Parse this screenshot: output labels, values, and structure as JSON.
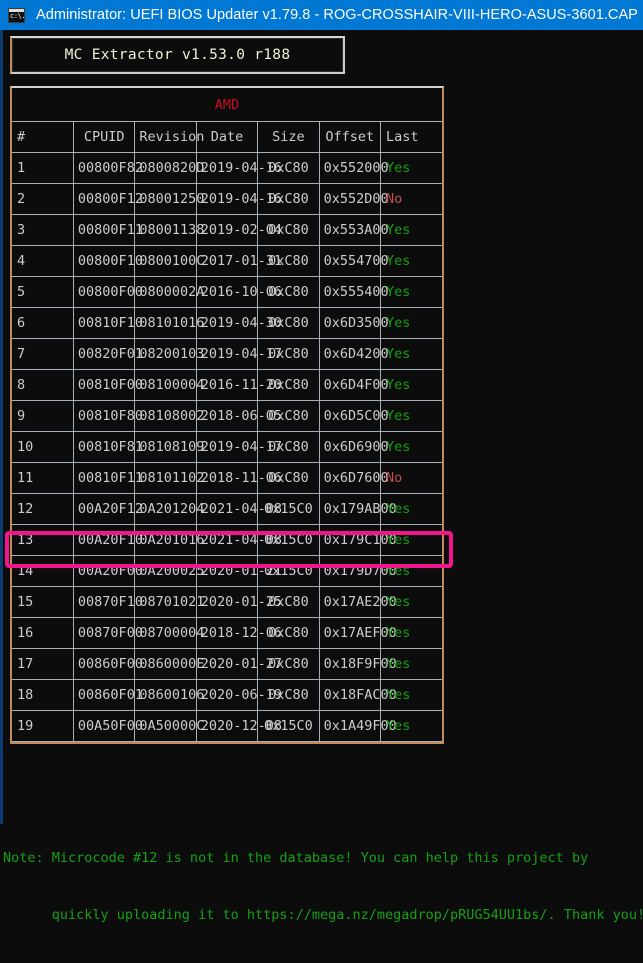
{
  "window": {
    "icon": "console-icon",
    "title": "Administrator:  UEFI BIOS Updater v1.79.8 - ROG-CROSSHAIR-VIII-HERO-ASUS-3601.CAP",
    "titlebar_color": "#0078d4"
  },
  "banner": {
    "text": "MC Extractor v1.53.0 r188"
  },
  "table": {
    "title": "AMD",
    "title_color": "#c50f1f",
    "columns": [
      "#",
      "CPUID",
      "Revision",
      "Date",
      "Size",
      "Offset",
      "Last"
    ],
    "rows": [
      {
        "num": "1",
        "cpuid": "00800F82",
        "revision": "0800820D",
        "date": "2019-04-16",
        "size": "0xC80",
        "offset": "0x552000",
        "last": "Yes"
      },
      {
        "num": "2",
        "cpuid": "00800F12",
        "revision": "08001250",
        "date": "2019-04-16",
        "size": "0xC80",
        "offset": "0x552D00",
        "last": "No"
      },
      {
        "num": "3",
        "cpuid": "00800F11",
        "revision": "08001138",
        "date": "2019-02-04",
        "size": "0xC80",
        "offset": "0x553A00",
        "last": "Yes"
      },
      {
        "num": "4",
        "cpuid": "00800F10",
        "revision": "0800100C",
        "date": "2017-01-31",
        "size": "0xC80",
        "offset": "0x554700",
        "last": "Yes"
      },
      {
        "num": "5",
        "cpuid": "00800F00",
        "revision": "0800002A",
        "date": "2016-10-06",
        "size": "0xC80",
        "offset": "0x555400",
        "last": "Yes"
      },
      {
        "num": "6",
        "cpuid": "00810F10",
        "revision": "08101016",
        "date": "2019-04-30",
        "size": "0xC80",
        "offset": "0x6D3500",
        "last": "Yes"
      },
      {
        "num": "7",
        "cpuid": "00820F01",
        "revision": "08200103",
        "date": "2019-04-17",
        "size": "0xC80",
        "offset": "0x6D4200",
        "last": "Yes"
      },
      {
        "num": "8",
        "cpuid": "00810F00",
        "revision": "08100004",
        "date": "2016-11-20",
        "size": "0xC80",
        "offset": "0x6D4F00",
        "last": "Yes"
      },
      {
        "num": "9",
        "cpuid": "00810F80",
        "revision": "08108002",
        "date": "2018-06-05",
        "size": "0xC80",
        "offset": "0x6D5C00",
        "last": "Yes"
      },
      {
        "num": "10",
        "cpuid": "00810F81",
        "revision": "08108109",
        "date": "2019-04-17",
        "size": "0xC80",
        "offset": "0x6D6900",
        "last": "Yes"
      },
      {
        "num": "11",
        "cpuid": "00810F11",
        "revision": "08101102",
        "date": "2018-11-06",
        "size": "0xC80",
        "offset": "0x6D7600",
        "last": "No"
      },
      {
        "num": "12",
        "cpuid": "00A20F12",
        "revision": "0A201204",
        "date": "2021-04-08",
        "size": "0x15C0",
        "offset": "0x179AB00",
        "last": "Yes"
      },
      {
        "num": "13",
        "cpuid": "00A20F10",
        "revision": "0A201016",
        "date": "2021-04-08",
        "size": "0x15C0",
        "offset": "0x179C100",
        "last": "Yes"
      },
      {
        "num": "14",
        "cpuid": "00A20F00",
        "revision": "0A200025",
        "date": "2020-01-21",
        "size": "0x15C0",
        "offset": "0x179D700",
        "last": "Yes"
      },
      {
        "num": "15",
        "cpuid": "00870F10",
        "revision": "08701021",
        "date": "2020-01-25",
        "size": "0xC80",
        "offset": "0x17AE200",
        "last": "Yes"
      },
      {
        "num": "16",
        "cpuid": "00870F00",
        "revision": "08700004",
        "date": "2018-12-06",
        "size": "0xC80",
        "offset": "0x17AEF00",
        "last": "Yes"
      },
      {
        "num": "17",
        "cpuid": "00860F00",
        "revision": "0860000E",
        "date": "2020-01-27",
        "size": "0xC80",
        "offset": "0x18F9F00",
        "last": "Yes"
      },
      {
        "num": "18",
        "cpuid": "00860F01",
        "revision": "08600106",
        "date": "2020-06-19",
        "size": "0xC80",
        "offset": "0x18FAC00",
        "last": "Yes"
      },
      {
        "num": "19",
        "cpuid": "00A50F00",
        "revision": "0A50000C",
        "date": "2020-12-08",
        "size": "0x15C0",
        "offset": "0x1A49F00",
        "last": "Yes"
      }
    ],
    "yes_color": "#13a10e",
    "no_color": "#c15055"
  },
  "highlight": {
    "target_row": "12",
    "color": "#f2158e"
  },
  "note": {
    "line1": "Note: Microcode #12 is not in the database! You can help this project by",
    "line2": "      quickly uploading it to https://mega.nz/megadrop/pRUG54UU1bs/. Thank you!",
    "color": "#16a016"
  }
}
